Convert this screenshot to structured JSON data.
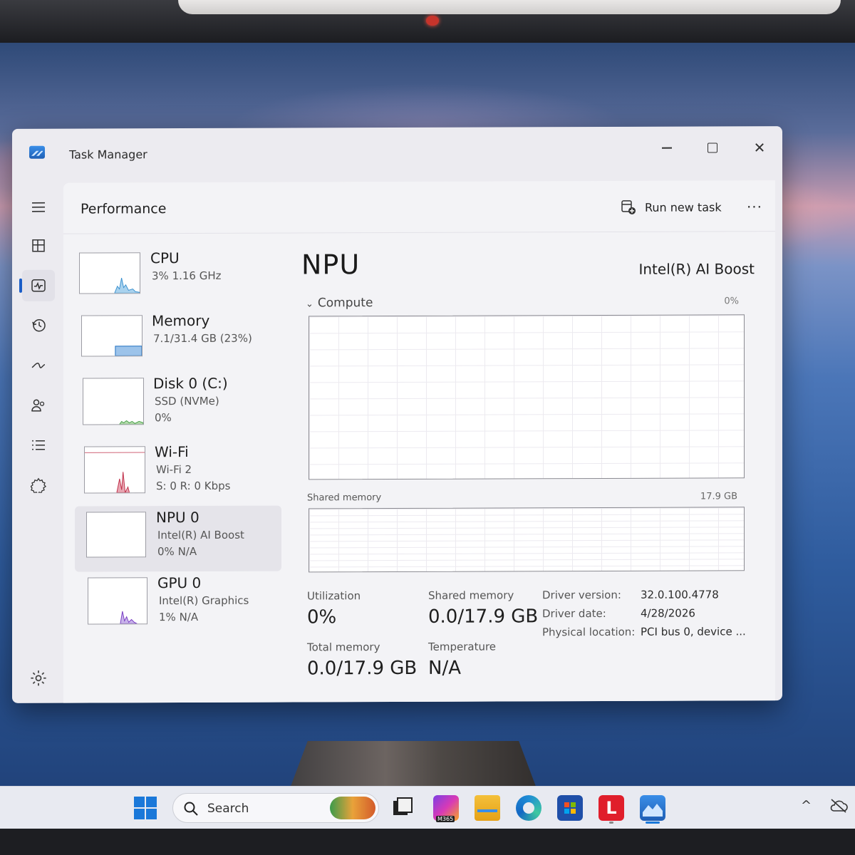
{
  "window": {
    "app_title": "Task Manager",
    "controls": {
      "minimize": "—",
      "close": "✕"
    }
  },
  "rail": {
    "items": [
      "menu-icon",
      "processes-icon",
      "performance-icon",
      "app-history-icon",
      "startup-apps-icon",
      "users-icon",
      "details-icon",
      "services-icon"
    ],
    "active": "performance-icon",
    "bottom": "settings-icon"
  },
  "header": {
    "page_title": "Performance",
    "run_new_task": "Run new task",
    "more": "···"
  },
  "devices": [
    {
      "name": "CPU",
      "sub": "3%  1.16 GHz",
      "sub2": "",
      "graph_color": "#3a91d0"
    },
    {
      "name": "Memory",
      "sub": "7.1/31.4 GB (23%)",
      "sub2": "",
      "graph_color": "#1e6fc0"
    },
    {
      "name": "Disk 0 (C:)",
      "sub": "SSD (NVMe)",
      "sub2": "0%",
      "graph_color": "#4aa24a"
    },
    {
      "name": "Wi-Fi",
      "sub": "Wi-Fi 2",
      "sub2": "S: 0  R: 0 Kbps",
      "graph_color": "#c0304a"
    },
    {
      "name": "NPU 0",
      "sub": "Intel(R) AI Boost",
      "sub2": "0%  N/A",
      "graph_color": "#1e6fc0",
      "selected": true
    },
    {
      "name": "GPU 0",
      "sub": "Intel(R) Graphics",
      "sub2": "1%  N/A",
      "graph_color": "#7a3fc4"
    }
  ],
  "detail": {
    "title": "NPU",
    "model": "Intel(R) AI Boost",
    "compute_label": "Compute",
    "compute_chevron": "⌄",
    "compute_pct": "0%",
    "shared_memory_label": "Shared memory",
    "shared_memory_max": "17.9 GB",
    "stats": {
      "utilization_label": "Utilization",
      "utilization_value": "0%",
      "shared_memory_label": "Shared memory",
      "shared_memory_value": "0.0/17.9 GB",
      "total_memory_label": "Total memory",
      "total_memory_value": "0.0/17.9 GB",
      "temperature_label": "Temperature",
      "temperature_value": "N/A"
    },
    "properties": [
      {
        "key": "Driver version:",
        "value": "32.0.100.4778"
      },
      {
        "key": "Driver date:",
        "value": "4/28/2026"
      },
      {
        "key": "Physical location:",
        "value": "PCI bus 0, device ..."
      }
    ]
  },
  "taskbar": {
    "search_placeholder": "Search",
    "apps": [
      "task-view-icon",
      "m365-copilot-icon",
      "file-explorer-icon",
      "edge-icon",
      "microsoft-store-icon",
      "lenovo-vantage-icon",
      "task-manager-icon"
    ],
    "m365_chip": "M365",
    "lenovo_letter": "L",
    "tray_chevron": "^",
    "accent": "#1a78d9"
  }
}
